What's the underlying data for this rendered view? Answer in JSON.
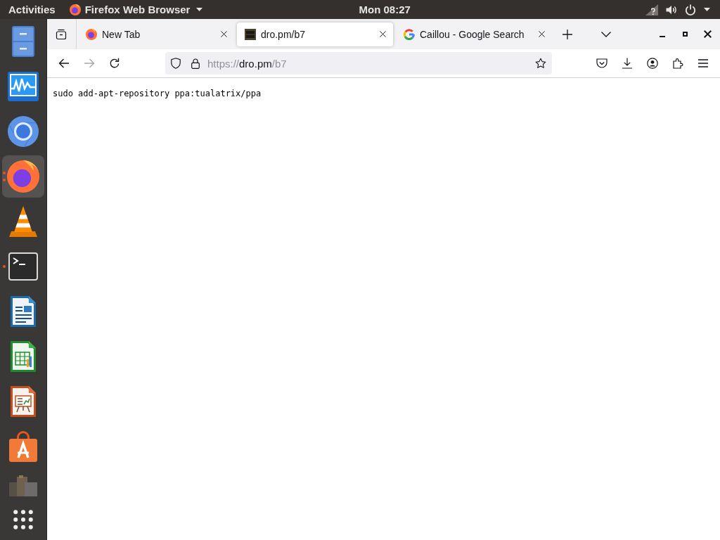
{
  "top_bar": {
    "activities": "Activities",
    "app_menu": "Firefox Web Browser",
    "clock": "Mon 08:27"
  },
  "dock": {
    "items": [
      {
        "kind": "files",
        "selected": false,
        "running": false,
        "multiple_windows": false
      },
      {
        "kind": "monitor",
        "selected": false,
        "running": false,
        "multiple_windows": false
      },
      {
        "kind": "chromium",
        "selected": false,
        "running": false,
        "multiple_windows": false
      },
      {
        "kind": "firefox",
        "selected": true,
        "running": true,
        "multiple_windows": true
      },
      {
        "kind": "vlc",
        "selected": false,
        "running": false,
        "multiple_windows": false
      },
      {
        "kind": "terminal",
        "selected": false,
        "running": true,
        "multiple_windows": false
      },
      {
        "kind": "writer",
        "selected": false,
        "running": false,
        "multiple_windows": false
      },
      {
        "kind": "calc",
        "selected": false,
        "running": false,
        "multiple_windows": false
      },
      {
        "kind": "impress",
        "selected": false,
        "running": false,
        "multiple_windows": false
      },
      {
        "kind": "software",
        "selected": false,
        "running": false,
        "multiple_windows": false
      },
      {
        "kind": "updater",
        "selected": false,
        "running": false,
        "multiple_windows": false
      },
      {
        "kind": "apps",
        "selected": false,
        "running": false,
        "multiple_windows": false
      }
    ]
  },
  "browser": {
    "tabs": [
      {
        "title": "New Tab",
        "favicon": {
          "kind": "firefox"
        },
        "selected": false
      },
      {
        "title": "dro.pm/b7",
        "favicon": {
          "kind": "site"
        },
        "selected": true
      },
      {
        "title": "Caillou - Google Search",
        "favicon": {
          "kind": "google"
        },
        "selected": false
      }
    ],
    "nav_buttons": [
      {
        "kind": "back",
        "disabled": false
      },
      {
        "kind": "forward",
        "disabled": true
      },
      {
        "kind": "reload",
        "disabled": false
      }
    ],
    "address_bar": {
      "scheme": "https://",
      "host": "dro.pm",
      "path": "/b7"
    }
  },
  "page": {
    "text": "sudo add-apt-repository ppa:tualatrix/ppa"
  }
}
